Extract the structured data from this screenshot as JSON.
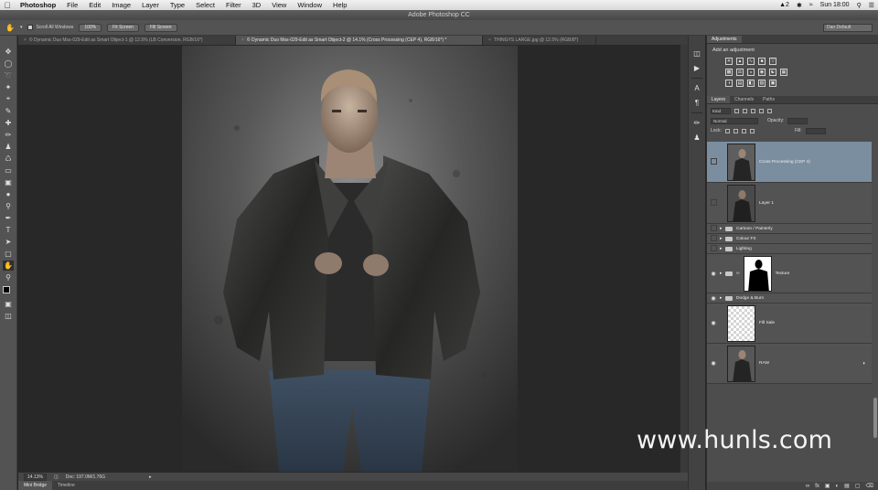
{
  "menubar": {
    "app": "Photoshop",
    "items": [
      "File",
      "Edit",
      "Image",
      "Layer",
      "Type",
      "Select",
      "Filter",
      "3D",
      "View",
      "Window",
      "Help"
    ],
    "status_badge": "2",
    "clock": "Sun 18:00"
  },
  "window": {
    "title": "Adobe Photoshop CC"
  },
  "options": {
    "scroll_all": "Scroll All Windows",
    "btn_100": "100%",
    "btn_fit": "Fit Screen",
    "btn_fill": "Fill Screen",
    "workspace": "Dan Default"
  },
  "tabs": [
    "© Dynamic Duo Mss-029-Edit as Smart Object-1 @ 12.5% (LB Conversion, RGB/16*)",
    "© Dynamic Duo Mss-029-Edit as Smart Object-2 @ 14.1% (Cross Processing (CEP 4), RGB/16*) *",
    "THINGYS LARGE.jpg @ 12.5% (RGB/8*)"
  ],
  "status": {
    "zoom": "14.13%",
    "doc": "Doc: 197.0M/1.76G"
  },
  "bottom_tabs": [
    "Mini Bridge",
    "Timeline"
  ],
  "panels": {
    "adjustments_tab": "Adjustments",
    "add_adjustment": "Add an adjustment",
    "layers_tabs": [
      "Layers",
      "Channels",
      "Paths"
    ],
    "kind": "Kind",
    "blend_mode": "Normal",
    "opacity_label": "Opacity:",
    "lock_label": "Lock:",
    "fill_label": "Fill:"
  },
  "layers": [
    {
      "name": "Cross Processing (CEP 4)",
      "type": "photo",
      "selected": true,
      "visible": false
    },
    {
      "name": "Layer 1",
      "type": "photo",
      "selected": false,
      "visible": false
    },
    {
      "name": "Cartoon / Painterly",
      "type": "group",
      "selected": false,
      "visible": false
    },
    {
      "name": "Colour FX",
      "type": "group",
      "selected": false,
      "visible": false
    },
    {
      "name": "Lighting",
      "type": "group",
      "selected": false,
      "visible": false
    },
    {
      "name": "Texture",
      "type": "mask-group",
      "selected": false,
      "visible": true
    },
    {
      "name": "Dodge & Burn",
      "type": "group",
      "selected": false,
      "visible": true
    },
    {
      "name": "Fill Sale",
      "type": "transparent",
      "selected": false,
      "visible": true
    },
    {
      "name": "RAW",
      "type": "photo",
      "selected": false,
      "visible": true
    }
  ],
  "watermark": "www.hunls.com"
}
